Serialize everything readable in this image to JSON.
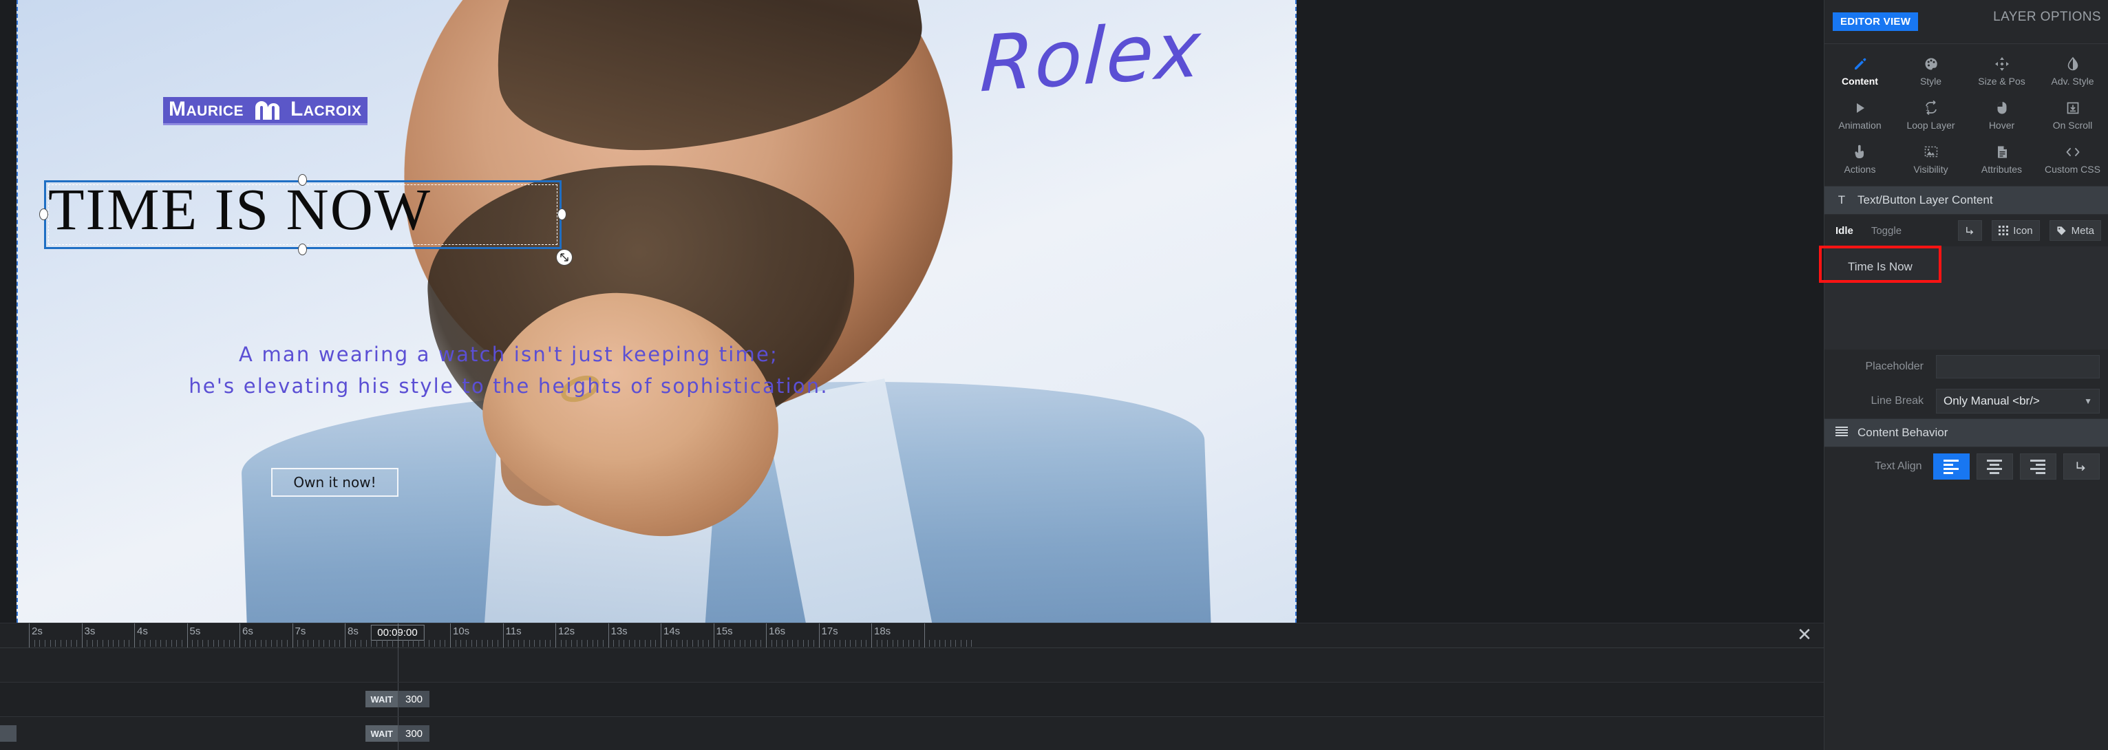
{
  "canvas": {
    "logo": {
      "word1": "Maurice",
      "word2": "Lacroix",
      "mark_icon": "ml-monogram-icon"
    },
    "headline": "TIME IS NOW",
    "body_line1": "A man wearing a watch isn't just keeping time;",
    "body_line2": "he's elevating his style to the heights of sophistication.",
    "cta_label": "Own it now!",
    "brand_script": "Rolex",
    "accent_color": "#5b4fd4",
    "selection_color": "#1f6fc4"
  },
  "timeline": {
    "current_time": "00:09:00",
    "close_label": "✕",
    "ticks": [
      "2s",
      "3s",
      "4s",
      "5s",
      "6s",
      "7s",
      "8s",
      "10s",
      "11s",
      "12s",
      "13s",
      "14s",
      "15s",
      "16s",
      "17s",
      "18s"
    ],
    "chips": [
      {
        "key": "WAIT",
        "value": "300"
      },
      {
        "key": "WAIT",
        "value": "300"
      }
    ]
  },
  "panel": {
    "editor_view_label": "EDITOR VIEW",
    "layer_options_label": "LAYER OPTIONS",
    "tabs": [
      {
        "label": "Content",
        "icon": "pencil-icon",
        "active": true
      },
      {
        "label": "Style",
        "icon": "palette-icon",
        "active": false
      },
      {
        "label": "Size & Pos",
        "icon": "move-arrows-icon",
        "active": false
      },
      {
        "label": "Adv. Style",
        "icon": "contrast-icon",
        "active": false
      },
      {
        "label": "Animation",
        "icon": "play-icon",
        "active": false
      },
      {
        "label": "Loop Layer",
        "icon": "loop-once-icon",
        "active": false
      },
      {
        "label": "Hover",
        "icon": "mouse-icon",
        "active": false
      },
      {
        "label": "On Scroll",
        "icon": "download-box-icon",
        "active": false
      },
      {
        "label": "Actions",
        "icon": "tap-hand-icon",
        "active": false
      },
      {
        "label": "Visibility",
        "icon": "image-dashed-icon",
        "active": false
      },
      {
        "label": "Attributes",
        "icon": "document-icon",
        "active": false
      },
      {
        "label": "Custom CSS",
        "icon": "code-icon",
        "active": false
      }
    ],
    "content_section": {
      "title": "Text/Button Layer Content",
      "title_icon": "text-t-icon",
      "states": [
        {
          "label": "Idle",
          "active": true
        },
        {
          "label": "Toggle",
          "active": false
        }
      ],
      "buttons": [
        {
          "label": "",
          "icon": "arrow-corner-icon"
        },
        {
          "label": "Icon",
          "icon": "grid-dots-icon"
        },
        {
          "label": "Meta",
          "icon": "tag-icon"
        }
      ],
      "textarea_value": "Time Is Now",
      "placeholder_label": "Placeholder",
      "placeholder_value": "",
      "line_break_label": "Line Break",
      "line_break_value": "Only Manual <br/>"
    },
    "behavior_section": {
      "title": "Content Behavior",
      "title_icon": "lines-icon",
      "text_align_label": "Text Align",
      "align_options": [
        {
          "icon": "align-left-icon",
          "active": true
        },
        {
          "icon": "align-center-icon",
          "active": false
        },
        {
          "icon": "align-right-icon",
          "active": false
        },
        {
          "icon": "align-wrap-icon",
          "active": false
        }
      ]
    }
  }
}
